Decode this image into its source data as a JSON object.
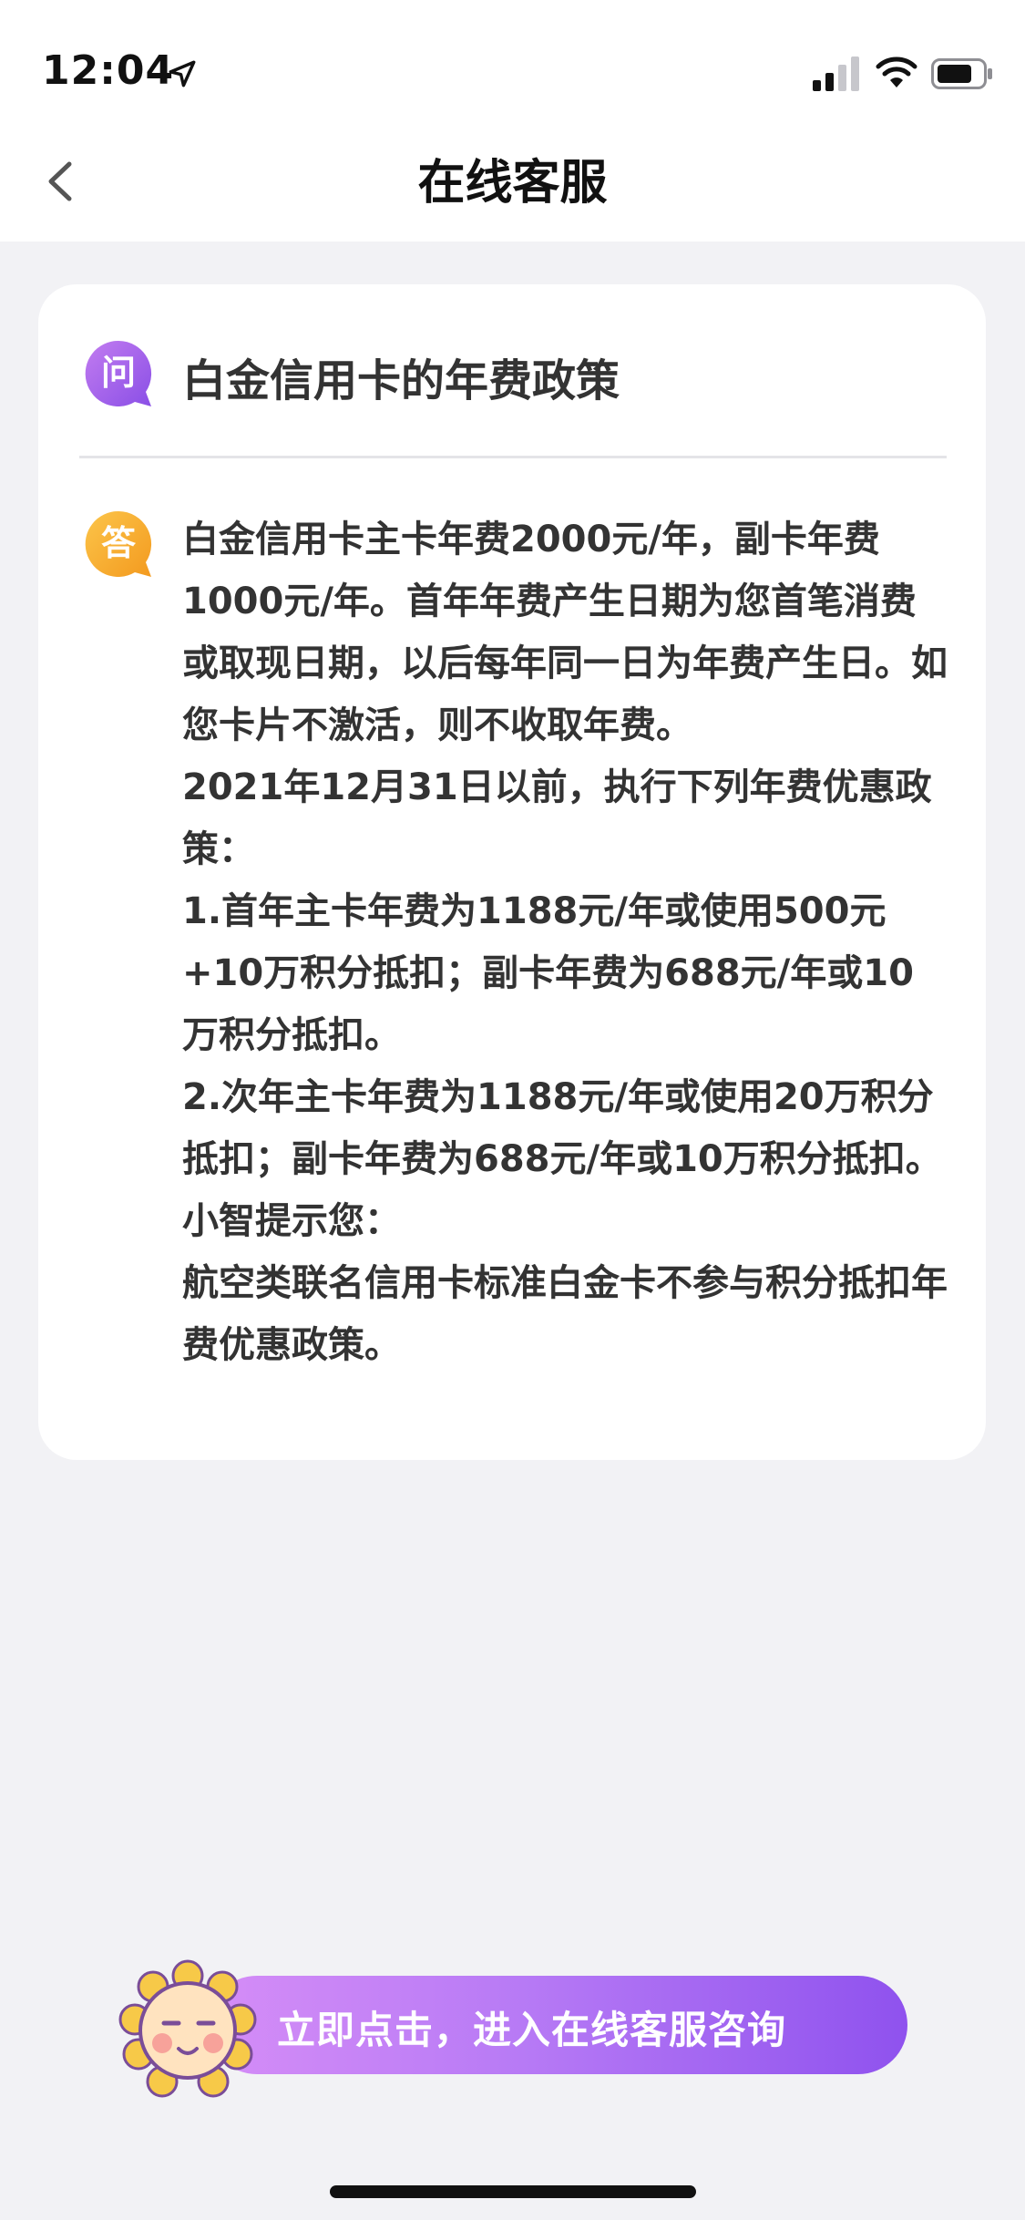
{
  "status_bar": {
    "time": "12:04"
  },
  "nav": {
    "title": "在线客服"
  },
  "qa": {
    "question": "白金信用卡的年费政策",
    "answer_lines": [
      "白金信用卡主卡年费2000元/年，副卡年费1000元/年。首年年费产生日期为您首笔消费或取现日期，以后每年同一日为年费产生日。如您卡片不激活，则不收取年费。",
      "2021年12月31日以前，执行下列年费优惠政策：",
      "1.首年主卡年费为1188元/年或使用500元+10万积分抵扣；副卡年费为688元/年或10万积分抵扣。",
      "2.次年主卡年费为1188元/年或使用20万积分抵扣；副卡年费为688元/年或10万积分抵扣。",
      "小智提示您：",
      "航空类联名信用卡标准白金卡不参与积分抵扣年费优惠政策。"
    ],
    "q_icon_text": "问",
    "a_icon_text": "答"
  },
  "cta": {
    "label": "立即点击，进入在线客服咨询"
  },
  "colors": {
    "accent_start": "#d58df7",
    "accent_end": "#8f52ee",
    "question_icon": "#9b59e8",
    "answer_icon": "#f5a623"
  },
  "icons": [
    "location-arrow-icon",
    "signal-icon",
    "wifi-icon",
    "battery-icon",
    "back-chevron-icon",
    "question-icon",
    "answer-icon",
    "mascot-icon"
  ]
}
